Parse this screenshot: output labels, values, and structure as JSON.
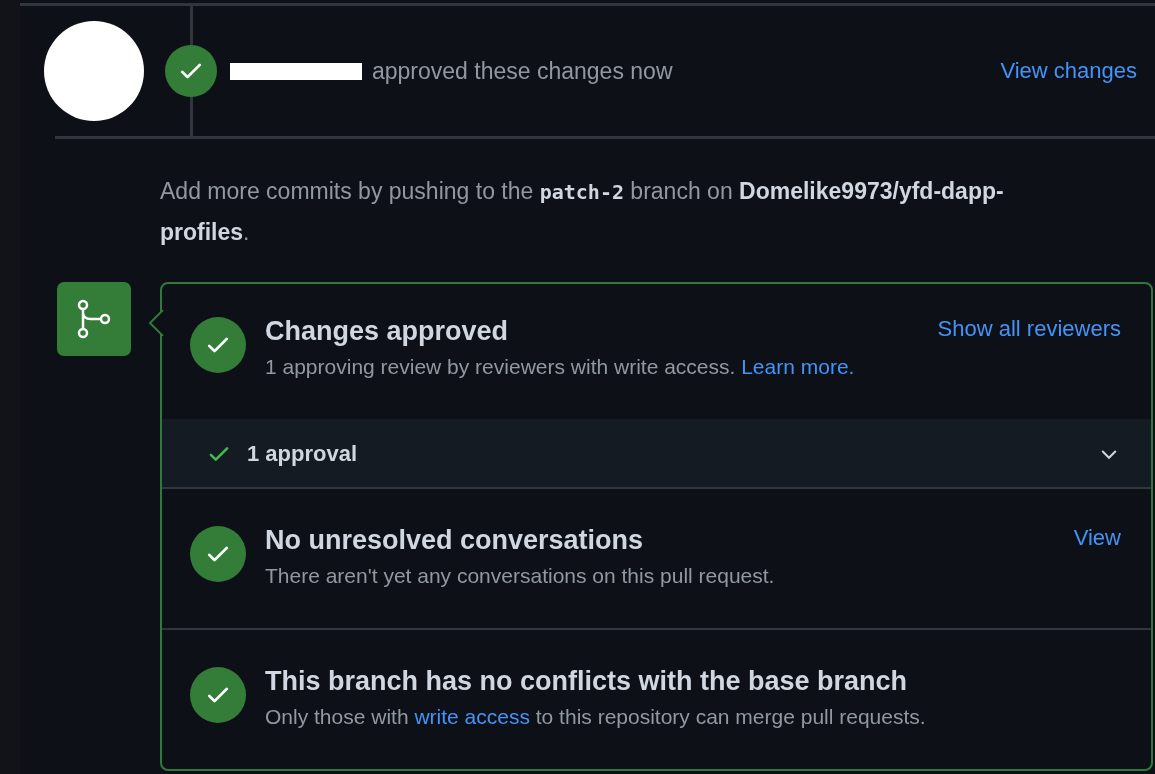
{
  "review": {
    "action": "approved these changes now",
    "link": "View changes"
  },
  "merge_hint": {
    "before": "Add more commits by pushing to the ",
    "branch": "patch-2",
    "middle": " branch on ",
    "repo": "Domelike9973/yfd-dapp-profiles",
    "after": "."
  },
  "checks": [
    {
      "title": "Changes approved",
      "link": "Show all reviewers",
      "description": [
        {
          "kind": "text",
          "text": "1 approving review by reviewers with write access. "
        },
        {
          "kind": "link",
          "text": "Learn more."
        }
      ]
    },
    {
      "title": "No unresolved conversations",
      "link": "View",
      "description": [
        {
          "kind": "text",
          "text": "There aren't yet any conversations on this pull request."
        }
      ]
    },
    {
      "title": "This branch has no conflicts with the base branch",
      "description": [
        {
          "kind": "text",
          "text": "Only those with "
        },
        {
          "kind": "link",
          "text": "write access"
        },
        {
          "kind": "text",
          "text": " to this repository can merge pull requests."
        }
      ]
    }
  ],
  "approvals": {
    "label": "1 approval",
    "expanded": false
  }
}
